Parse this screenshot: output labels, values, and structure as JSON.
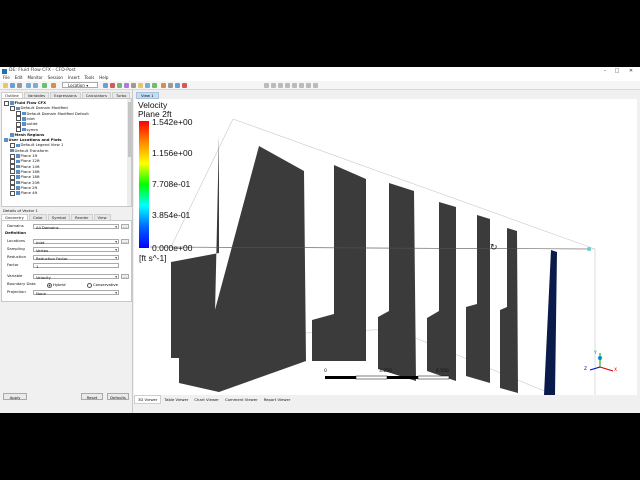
{
  "window": {
    "title": "DE: Fluid Flow CFX - CFD-Post"
  },
  "menu": [
    "File",
    "Edit",
    "Monitor",
    "Session",
    "Insert",
    "Tools",
    "Help"
  ],
  "toolbar": {
    "location_label": "Location"
  },
  "left_tabs": [
    "Outline",
    "Variables",
    "Expressions",
    "Calculators",
    "Turbo"
  ],
  "tree": [
    {
      "label": "Fluid Flow CFX",
      "bold": true
    },
    {
      "label": "Default Domain Modified",
      "bold": false
    },
    {
      "label": "Default Domain Modified Default",
      "bold": false
    },
    {
      "label": "inlet",
      "bold": false
    },
    {
      "label": "outlet",
      "bold": false
    },
    {
      "label": "symm",
      "bold": false
    },
    {
      "label": "Mesh Regions",
      "bold": true
    },
    {
      "label": "User Locations and Plots",
      "bold": true
    },
    {
      "label": "Default Legend View 1",
      "bold": false
    },
    {
      "label": "Default Transform",
      "bold": false
    },
    {
      "label": "Plane 1ft",
      "bold": false
    },
    {
      "label": "Plane 12ft",
      "bold": false
    },
    {
      "label": "Plane 14ft",
      "bold": false
    },
    {
      "label": "Plane 16ft",
      "bold": false
    },
    {
      "label": "Plane 18ft",
      "bold": false
    },
    {
      "label": "Plane 20ft",
      "bold": false
    },
    {
      "label": "Plane 2ft",
      "bold": false
    },
    {
      "label": "Plane 4ft",
      "bold": false
    }
  ],
  "details": {
    "title": "Details of Vector 1",
    "tabs": [
      "Geometry",
      "Color",
      "Symbol",
      "Render",
      "View"
    ],
    "domains_label": "Domains",
    "domains_value": "All Domains",
    "definition_label": "Definition",
    "locations_label": "Locations",
    "locations_value": "Inlet",
    "sampling_label": "Sampling",
    "sampling_value": "Vertex",
    "reduction_label": "Reduction",
    "reduction_value": "Reduction Factor",
    "factor_label": "Factor",
    "factor_value": "1",
    "variable_label": "Variable",
    "variable_value": "Velocity",
    "boundary_label": "Boundary Data",
    "hybrid_label": "Hybrid",
    "conservative_label": "Conservative",
    "projection_label": "Projection",
    "projection_value": "None",
    "apply_label": "Apply",
    "reset_label": "Reset",
    "defaults_label": "Defaults"
  },
  "viewer": {
    "tab_label": "View 1",
    "bottom_tabs": [
      "3D Viewer",
      "Table Viewer",
      "Chart Viewer",
      "Comment Viewer",
      "Report Viewer"
    ]
  },
  "legend": {
    "title_line1": "Velocity",
    "title_line2": "Plane 2ft",
    "ticks": [
      "1.542e+00",
      "1.156e+00",
      "7.708e-01",
      "3.854e-01",
      "0.000e+00"
    ],
    "unit": "[ft s^-1]"
  },
  "scale": {
    "left": "0",
    "mid": "3.250",
    "right": "6.500"
  },
  "axes": {
    "x": "X",
    "y": "Y",
    "z": "Z"
  },
  "colors": {
    "plane": "#3b3b3b",
    "accent_plane": "#0a1a4a",
    "selection": "#c9dbf0"
  }
}
